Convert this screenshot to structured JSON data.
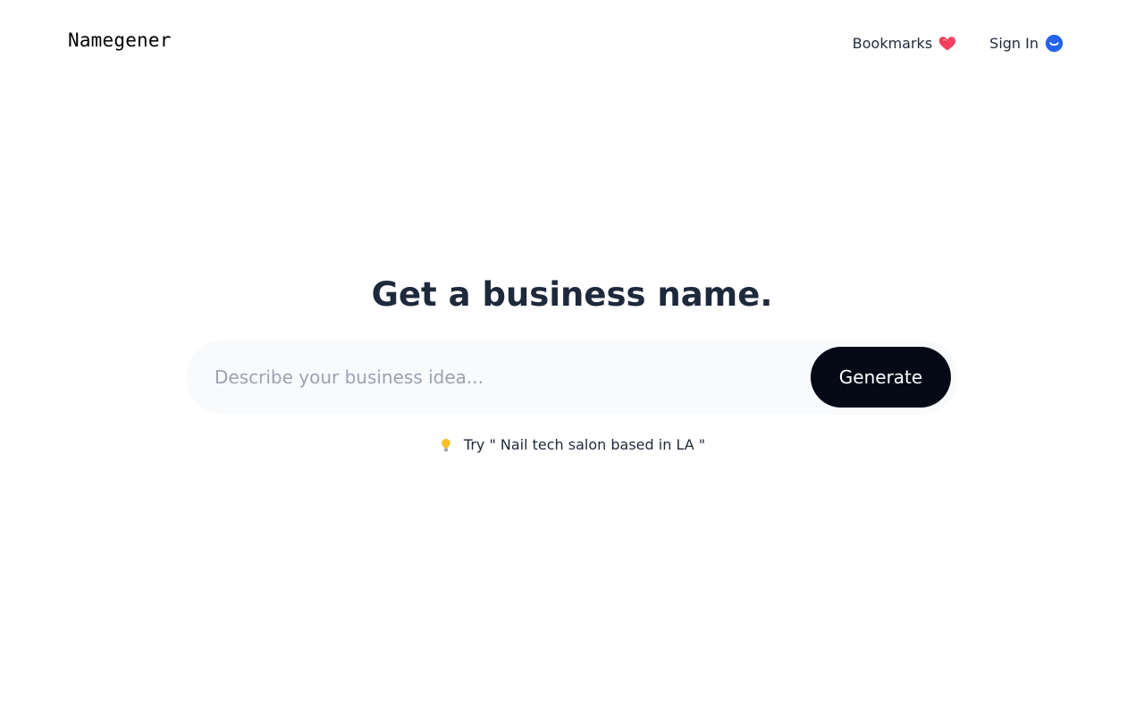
{
  "header": {
    "logo": "Namegener",
    "nav": {
      "bookmarks_label": "Bookmarks",
      "bookmarks_icon": "heart-icon",
      "sign_in_label": "Sign In",
      "sign_in_icon": "smiley-icon"
    }
  },
  "hero": {
    "title": "Get a business name.",
    "search": {
      "placeholder": "Describe your business idea...",
      "value": ""
    },
    "generate_label": "Generate",
    "suggestion": {
      "icon": "lightbulb-icon",
      "text": "Try \" Nail tech salon based in LA \""
    }
  },
  "colors": {
    "heart": "#f43f5e",
    "sign_in_badge": "#2563eb",
    "button_bg": "#060a17",
    "title": "#1e293b",
    "search_bg": "#f8fafc"
  }
}
